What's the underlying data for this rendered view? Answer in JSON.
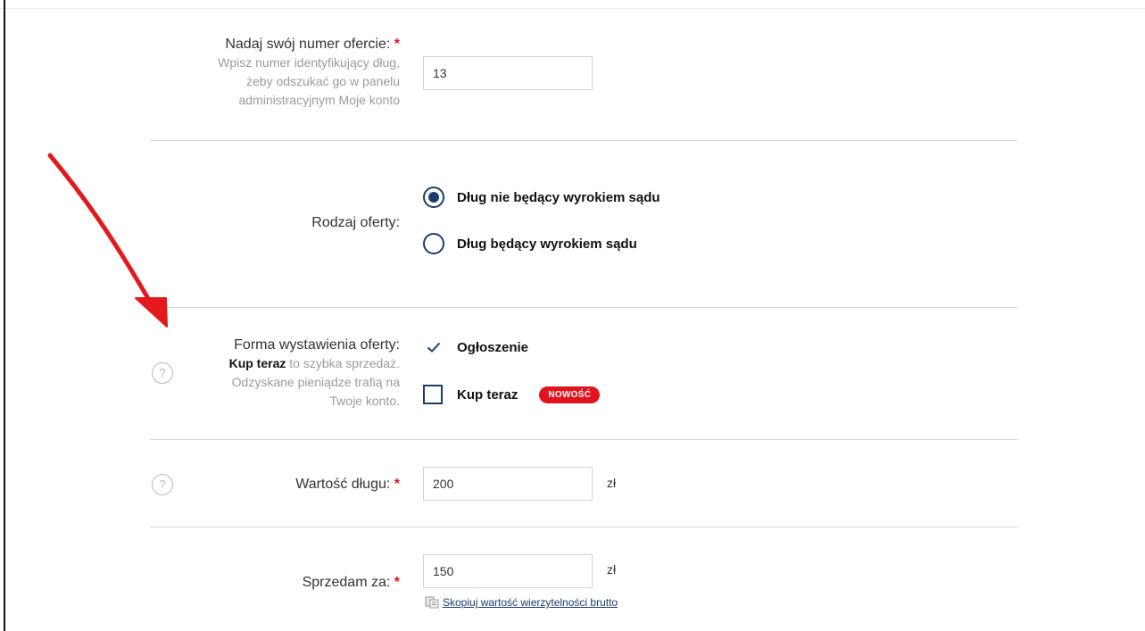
{
  "offer_number": {
    "label": "Nadaj swój numer ofercie:",
    "required_mark": "*",
    "hint": "Wpisz numer identyfikujący dług, żeby odszukać go w panelu administracyjnym Moje konto",
    "value": "13"
  },
  "offer_type": {
    "label": "Rodzaj oferty:",
    "options": [
      {
        "label": "Dług nie będący wyrokiem sądu",
        "selected": true
      },
      {
        "label": "Dług będący wyrokiem sądu",
        "selected": false
      }
    ]
  },
  "listing_form": {
    "label": "Forma wystawienia oferty:",
    "hint_bold": "Kup teraz",
    "hint_rest": "to szybka sprzedaż. Odzyskane pieniądze trafią na Twoje konto.",
    "options": [
      {
        "label": "Ogłoszenie",
        "checked": true
      },
      {
        "label": "Kup teraz",
        "checked": false,
        "badge": "NOWOŚĆ"
      }
    ]
  },
  "debt_value": {
    "label": "Wartość długu:",
    "required_mark": "*",
    "value": "200",
    "unit": "zł"
  },
  "sell_for": {
    "label": "Sprzedam za:",
    "required_mark": "*",
    "value": "150",
    "unit": "zł",
    "copy_link": "Skopiuj wartość wierzytelności brutto"
  },
  "help_icon_glyph": "?",
  "colors": {
    "accent": "#1a3d6d",
    "required": "#e1141e",
    "annotation_arrow": "#e3191c",
    "hint_text": "#9b9b9b",
    "divider": "#d9d9d9"
  }
}
